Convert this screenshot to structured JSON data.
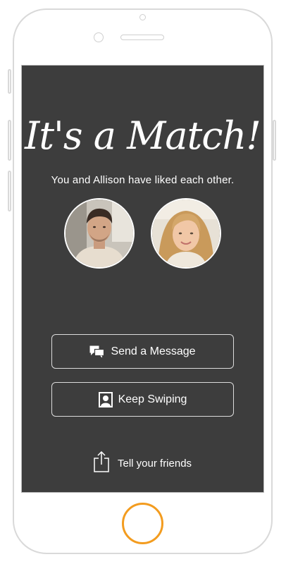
{
  "match_screen": {
    "title": "It's a Match!",
    "subtitle": "You and Allison have liked each other.",
    "buttons": {
      "send_message": "Send a Message",
      "keep_swiping": "Keep Swiping"
    },
    "share_label": "Tell your friends"
  },
  "icons": {
    "send_message": "chat-bubbles-icon",
    "keep_swiping": "person-card-icon",
    "share": "share-icon"
  },
  "colors": {
    "screen_bg": "#3d3d3d",
    "text": "#ffffff",
    "home_button": "#f39c1f",
    "frame": "#d9d9d9"
  }
}
